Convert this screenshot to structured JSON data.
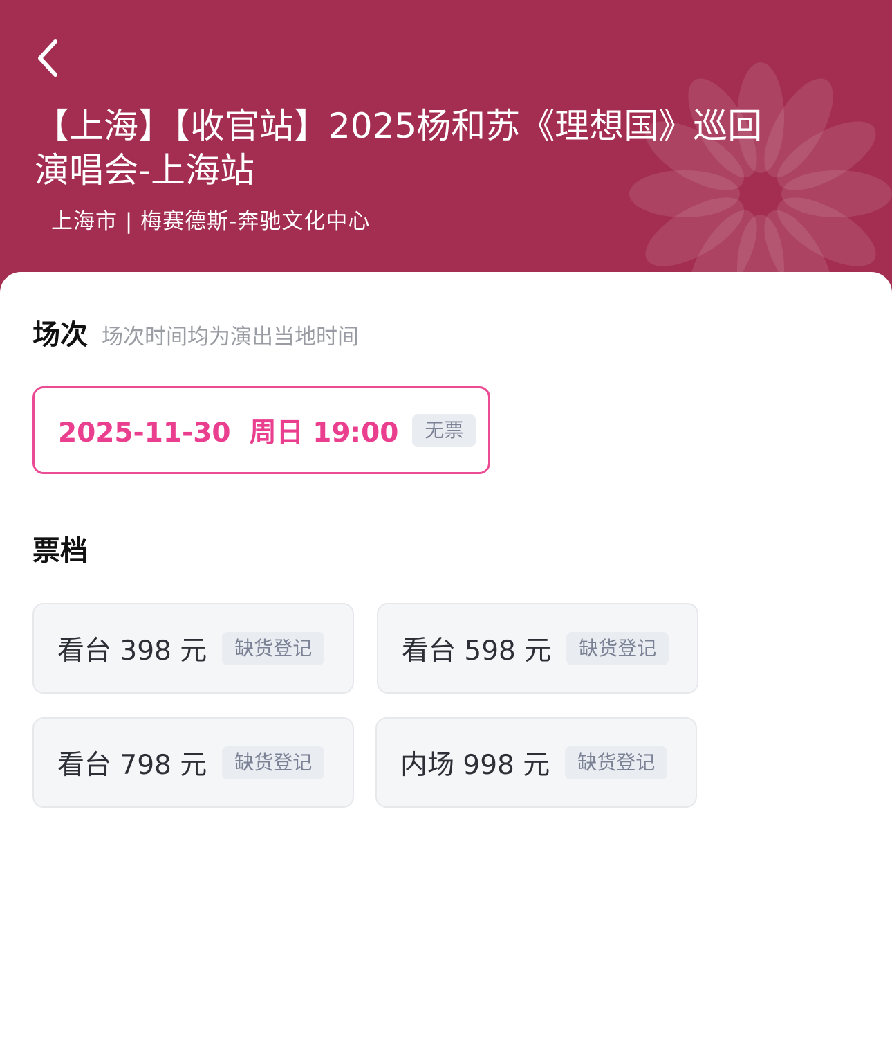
{
  "header": {
    "title": "【上海】【收官站】2025杨和苏《理想国》巡回 演唱会-上海站",
    "venue": "上海市 | 梅赛德斯-奔驰文化中心"
  },
  "session_section": {
    "title": "场次",
    "note": "场次时间均为演出当地时间",
    "selected": {
      "datetime": "2025-11-30  周日 19:00",
      "status": "无票"
    }
  },
  "tier_section": {
    "title": "票档",
    "tiers": [
      {
        "label": "看台 398 元",
        "status": "缺货登记"
      },
      {
        "label": "看台 598 元",
        "status": "缺货登记"
      },
      {
        "label": "看台 798 元",
        "status": "缺货登记"
      },
      {
        "label": "内场 998 元",
        "status": "缺货登记"
      }
    ]
  },
  "colors": {
    "header_bg": "#a32e52",
    "accent": "#ea3f8f",
    "badge_bg": "#e9ecf1",
    "badge_text": "#7b8295"
  }
}
